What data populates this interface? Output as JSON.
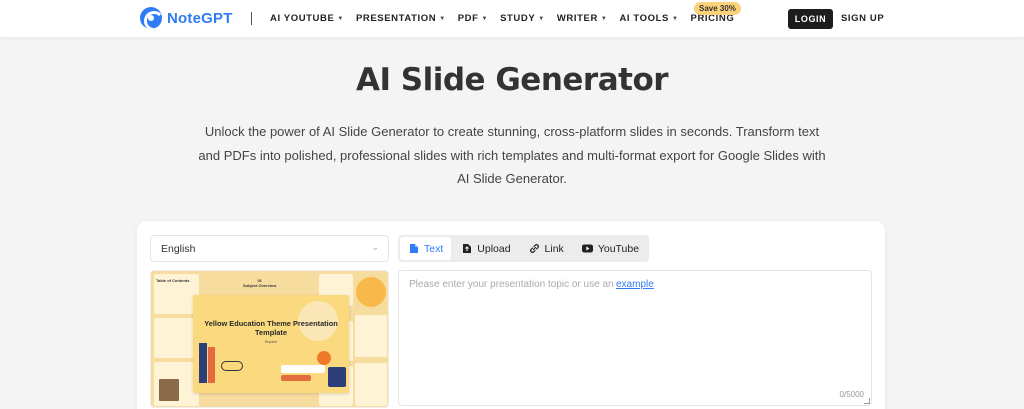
{
  "header": {
    "logo_text": "NoteGPT",
    "nav": [
      {
        "label": "AI YOUTUBE",
        "has_caret": true
      },
      {
        "label": "PRESENTATION",
        "has_caret": true
      },
      {
        "label": "PDF",
        "has_caret": true
      },
      {
        "label": "STUDY",
        "has_caret": true
      },
      {
        "label": "WRITER",
        "has_caret": true
      },
      {
        "label": "AI TOOLS",
        "has_caret": true
      },
      {
        "label": "PRICING",
        "has_caret": false
      }
    ],
    "save_badge": "Save 30%",
    "login_label": "LOGIN",
    "signup_label": "SIGN UP"
  },
  "hero": {
    "title": "AI Slide Generator",
    "description": "Unlock the power of AI Slide Generator to create stunning, cross-platform slides in seconds. Transform text and PDFs into polished, professional slides with rich templates and multi-format export for Google Slides with AI Slide Generator."
  },
  "generator": {
    "language": "English",
    "tabs": [
      {
        "label": "Text",
        "icon": "document-icon",
        "active": true
      },
      {
        "label": "Upload",
        "icon": "upload-file-icon",
        "active": false
      },
      {
        "label": "Link",
        "icon": "link-icon",
        "active": false
      },
      {
        "label": "YouTube",
        "icon": "youtube-icon",
        "active": false
      }
    ],
    "template_preview": {
      "title": "Yellow Education Theme Presentation Template",
      "subtitle": "Reporter",
      "toc_label": "Table of Contents",
      "subject_label": "01\nSubject Overview"
    },
    "prompt": {
      "placeholder": "Please enter your presentation topic or use an",
      "example_link": "example",
      "counter": "0/5000"
    }
  },
  "colors": {
    "brand": "#2f7cf6",
    "badge": "#fbd27a",
    "login_bg": "#1d1d1f"
  }
}
